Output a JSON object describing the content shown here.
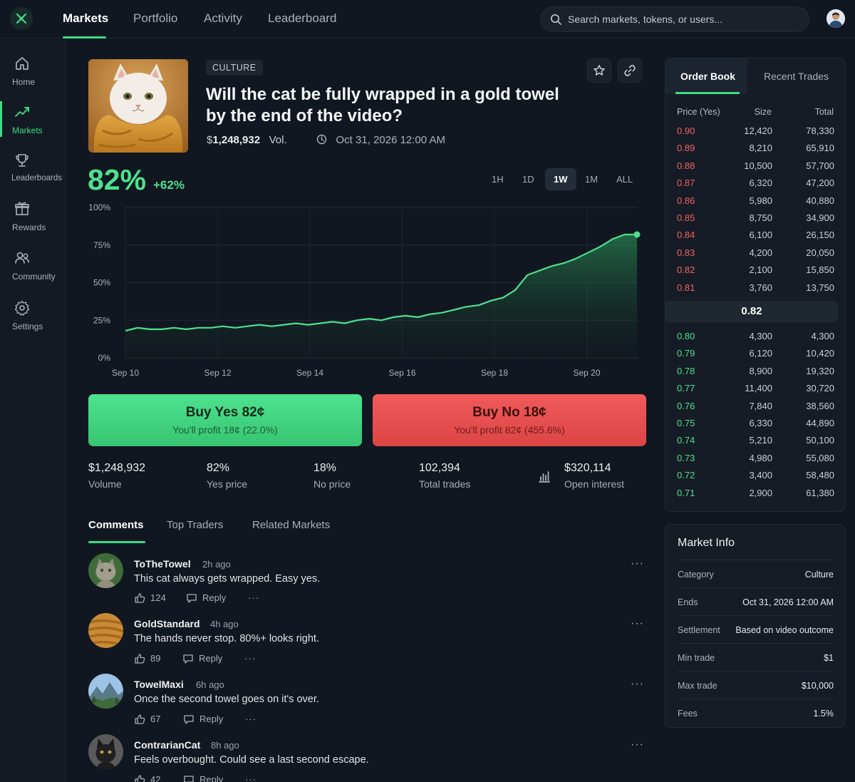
{
  "nav": {
    "tabs": [
      "Markets",
      "Portfolio",
      "Activity",
      "Leaderboard"
    ],
    "search_placeholder": "Search markets, tokens, or users..."
  },
  "sidebar": {
    "items": [
      {
        "label": "Home",
        "icon": "home-icon"
      },
      {
        "label": "Markets",
        "icon": "trending-icon"
      },
      {
        "label": "Leaderboards",
        "icon": "trophy-icon"
      },
      {
        "label": "Rewards",
        "icon": "gift-icon"
      },
      {
        "label": "Community",
        "icon": "users-icon"
      },
      {
        "label": "Settings",
        "icon": "gear-icon"
      }
    ]
  },
  "market": {
    "tag": "CULTURE",
    "title": "Will the cat be fully wrapped in a gold towel by the end of the video?",
    "volume_symbol": "$",
    "volume": "1,248,932",
    "volume_suffix": "Vol.",
    "end_date": "Oct 31, 2026 12:00 AM",
    "probability": "82%",
    "change": "+62%",
    "ranges": [
      "1H",
      "1D",
      "1W",
      "1M",
      "ALL"
    ],
    "active_range": "1W"
  },
  "chart_data": {
    "type": "area",
    "ylim": [
      0,
      100
    ],
    "y_ticks": [
      "0%",
      "25%",
      "50%",
      "75%",
      "100%"
    ],
    "x_ticks": [
      "Sep 10",
      "Sep 12",
      "Sep 14",
      "Sep 16",
      "Sep 18",
      "Sep 20"
    ],
    "x_range": [
      "Sep 10",
      "Sep 21 (approx.)"
    ],
    "grid": true,
    "series": [
      {
        "values": [
          18,
          20,
          19,
          19,
          20,
          19,
          20,
          20,
          21,
          20,
          21,
          22,
          21,
          22,
          23,
          22,
          23,
          24,
          23,
          25,
          26,
          25,
          27,
          28,
          27,
          29,
          30,
          32,
          34,
          35,
          38,
          40,
          45,
          55,
          58,
          61,
          63,
          66,
          70,
          74,
          79,
          82,
          82
        ]
      }
    ],
    "color": "#4ee08e"
  },
  "trade": {
    "yes_label": "Buy Yes 82¢",
    "yes_profit": "You'll profit 18¢ (22.0%)",
    "no_label": "Buy No 18¢",
    "no_profit": "You'll profit 82¢ (455.6%)"
  },
  "stats": [
    {
      "value": "$1,248,932",
      "label": "Volume"
    },
    {
      "value": "82%",
      "label": "Yes price"
    },
    {
      "value": "18%",
      "label": "No price"
    },
    {
      "value": "102,394",
      "label": "Total trades"
    },
    {
      "value": "$320,114",
      "label": "Open interest"
    }
  ],
  "tabs": [
    "Comments",
    "Top Traders",
    "Related Markets"
  ],
  "comments": [
    {
      "user": "ToTheTowel",
      "time": "2h ago",
      "text": "This cat always gets wrapped. Easy yes.",
      "likes": "124",
      "reply": "Reply"
    },
    {
      "user": "GoldStandard",
      "time": "4h ago",
      "text": "The hands never stop. 80%+ looks right.",
      "likes": "89",
      "reply": "Reply"
    },
    {
      "user": "TowelMaxi",
      "time": "6h ago",
      "text": "Once the second towel goes on it's over.",
      "likes": "67",
      "reply": "Reply"
    },
    {
      "user": "ContrarianCat",
      "time": "8h ago",
      "text": "Feels overbought. Could see a last second escape.",
      "likes": "42",
      "reply": "Reply"
    }
  ],
  "orderbook": {
    "tabs": [
      "Order Book",
      "Recent Trades"
    ],
    "headers": [
      "Price (Yes)",
      "Size",
      "Total"
    ],
    "asks": [
      [
        "0.90",
        "12,420",
        "78,330"
      ],
      [
        "0.89",
        "8,210",
        "65,910"
      ],
      [
        "0.88",
        "10,500",
        "57,700"
      ],
      [
        "0.87",
        "6,320",
        "47,200"
      ],
      [
        "0.86",
        "5,980",
        "40,880"
      ],
      [
        "0.85",
        "8,750",
        "34,900"
      ],
      [
        "0.84",
        "6,100",
        "26,150"
      ],
      [
        "0.83",
        "4,200",
        "20,050"
      ],
      [
        "0.82",
        "2,100",
        "15,850"
      ],
      [
        "0.81",
        "3,760",
        "13,750"
      ]
    ],
    "mid": "0.82",
    "bids": [
      [
        "0.80",
        "4,300",
        "4,300"
      ],
      [
        "0.79",
        "6,120",
        "10,420"
      ],
      [
        "0.78",
        "8,900",
        "19,320"
      ],
      [
        "0.77",
        "11,400",
        "30,720"
      ],
      [
        "0.76",
        "7,840",
        "38,560"
      ],
      [
        "0.75",
        "6,330",
        "44,890"
      ],
      [
        "0.74",
        "5,210",
        "50,100"
      ],
      [
        "0.73",
        "4,980",
        "55,080"
      ],
      [
        "0.72",
        "3,400",
        "58,480"
      ],
      [
        "0.71",
        "2,900",
        "61,380"
      ]
    ]
  },
  "market_info": {
    "title": "Market Info",
    "rows": [
      {
        "k": "Category",
        "v": "Culture"
      },
      {
        "k": "Ends",
        "v": "Oct 31, 2026 12:00 AM"
      },
      {
        "k": "Settlement",
        "v": "Based on video outcome"
      },
      {
        "k": "Min trade",
        "v": "$1"
      },
      {
        "k": "Max trade",
        "v": "$10,000"
      },
      {
        "k": "Fees",
        "v": "1.5%"
      }
    ]
  },
  "colors": {
    "accent": "#3ddc84",
    "yes": "#4ee08e",
    "no": "#f06262",
    "background": "#111720"
  }
}
